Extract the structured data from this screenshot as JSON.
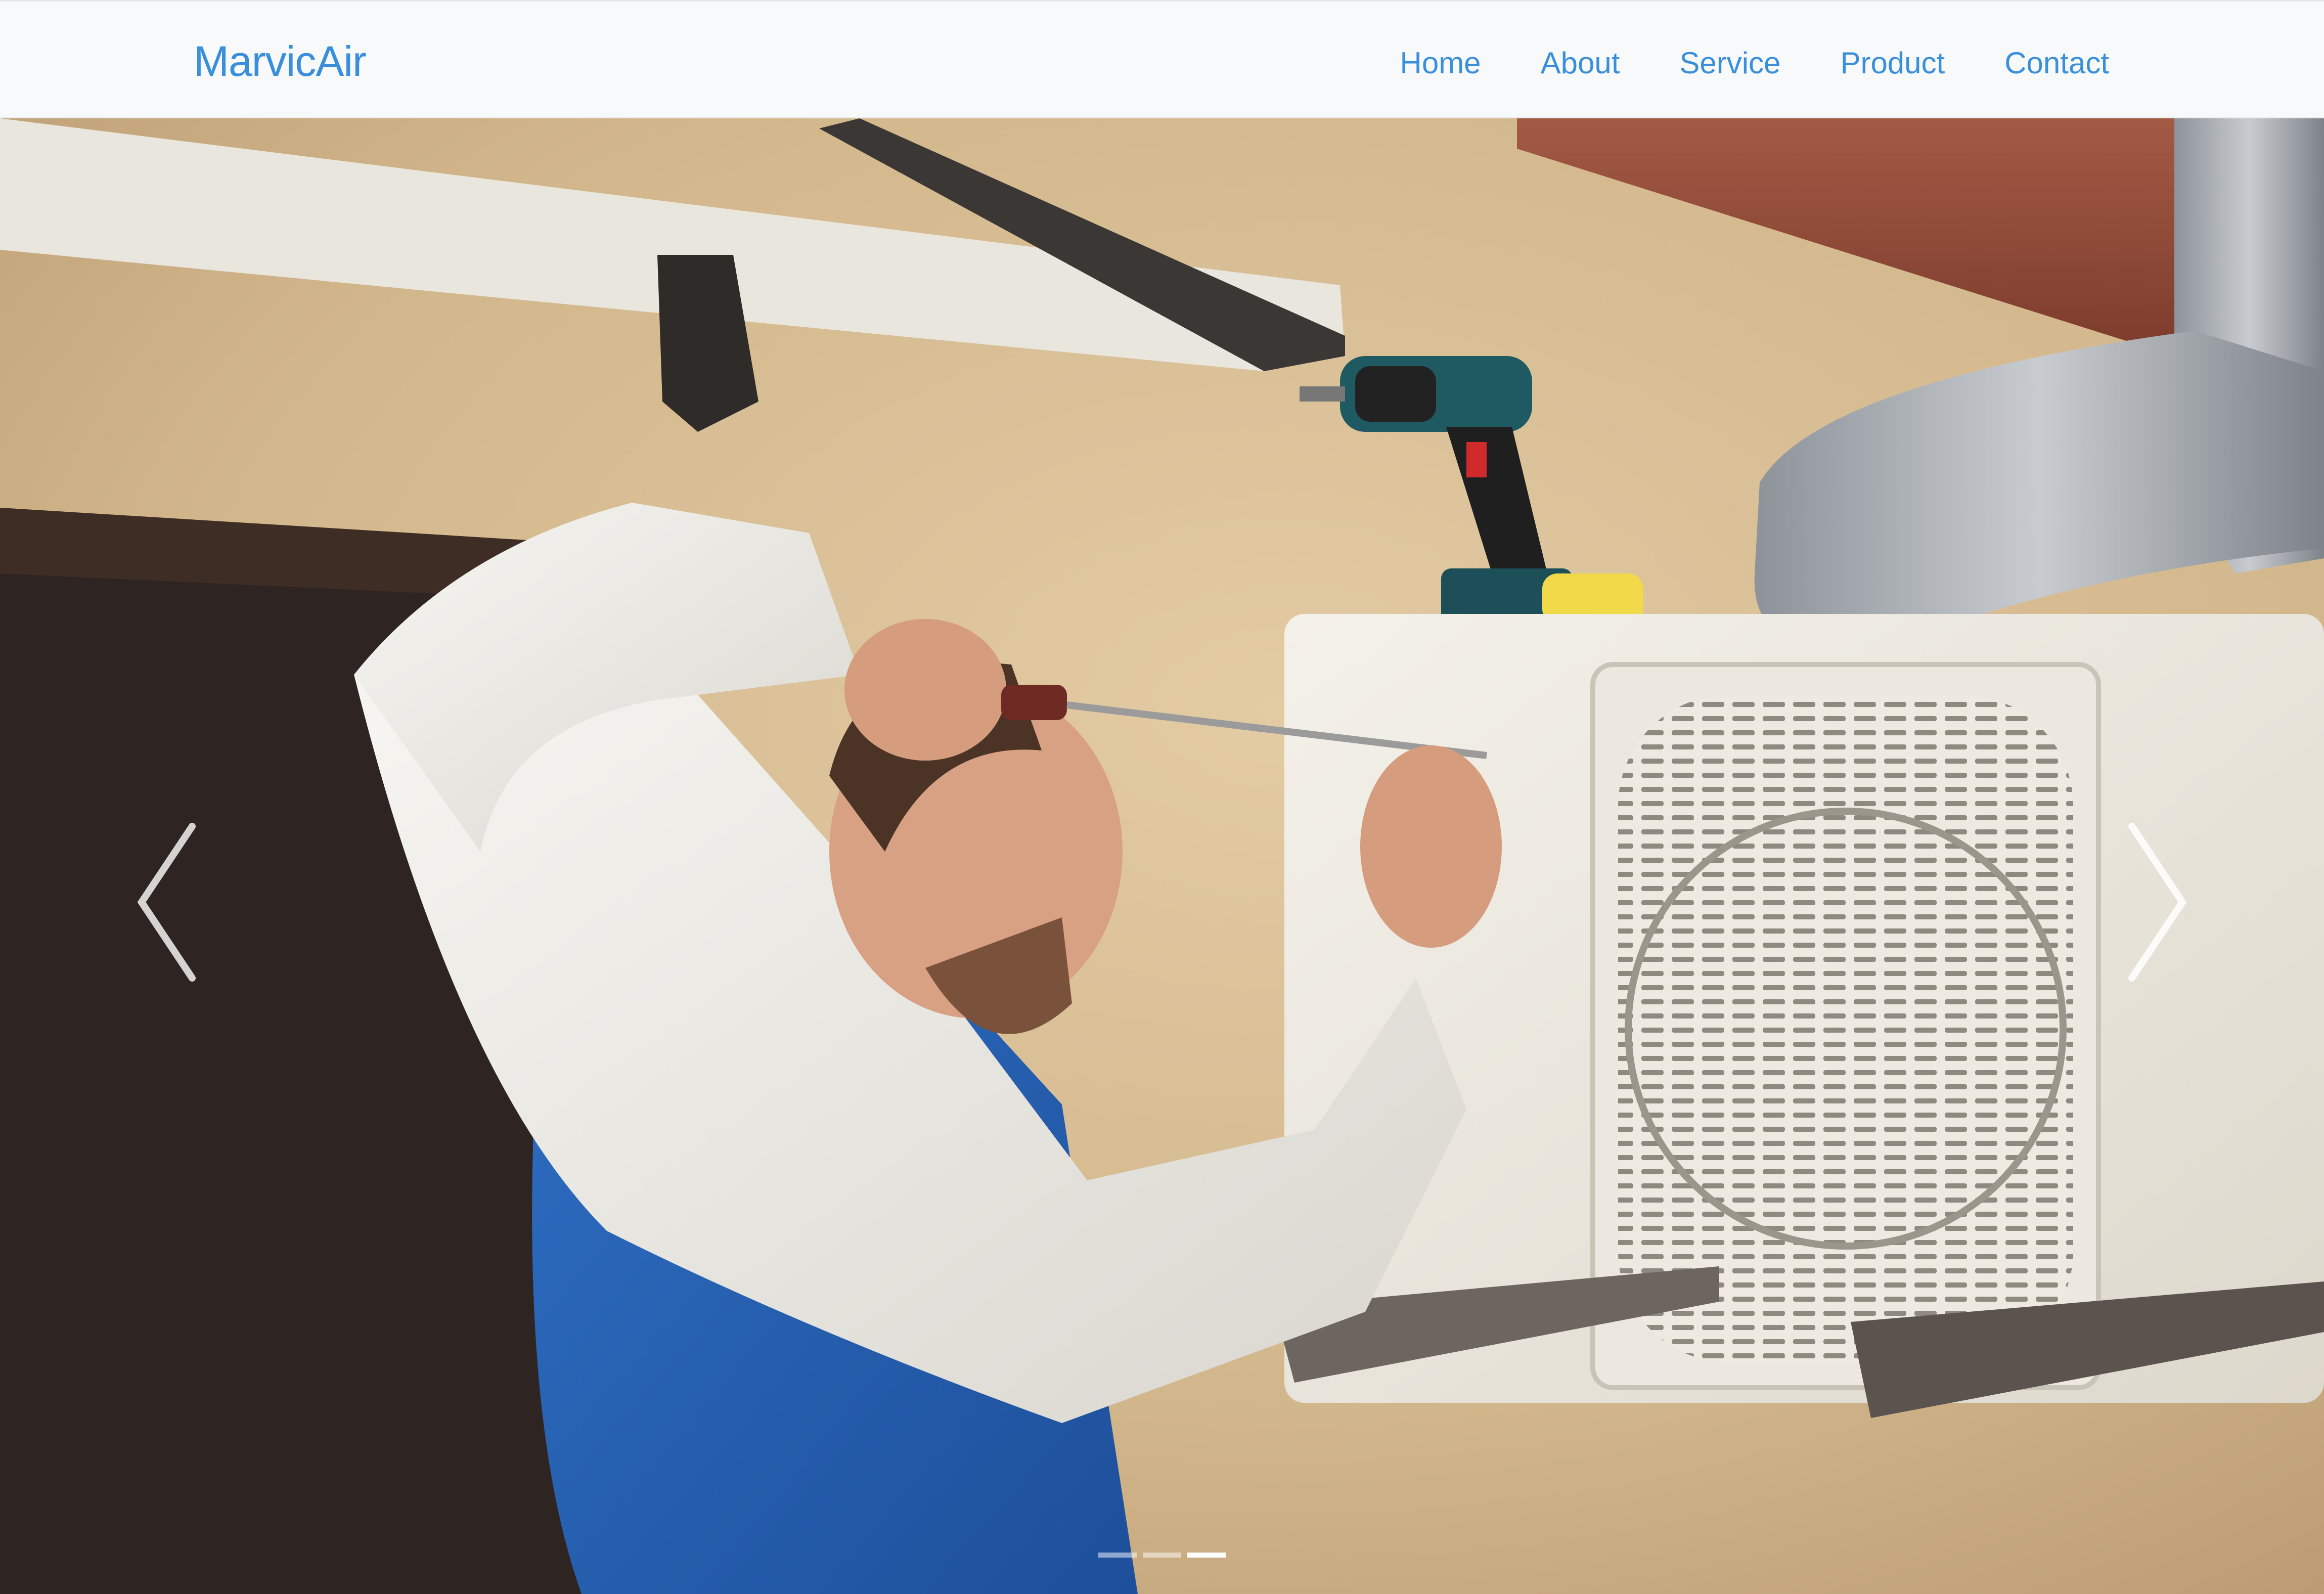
{
  "navbar": {
    "brand": "MarvicAir",
    "links": [
      {
        "label": "Home"
      },
      {
        "label": "About"
      },
      {
        "label": "Service"
      },
      {
        "label": "Product"
      },
      {
        "label": "Contact"
      }
    ],
    "link_color": "#3a8fdd",
    "background": "#f8f9fa"
  },
  "carousel": {
    "slide_image": "technician-repairing-air-conditioner-unit",
    "prev_icon": "chevron-left-icon",
    "next_icon": "chevron-right-icon",
    "indicators": {
      "count": 3,
      "active_index": 2
    }
  }
}
